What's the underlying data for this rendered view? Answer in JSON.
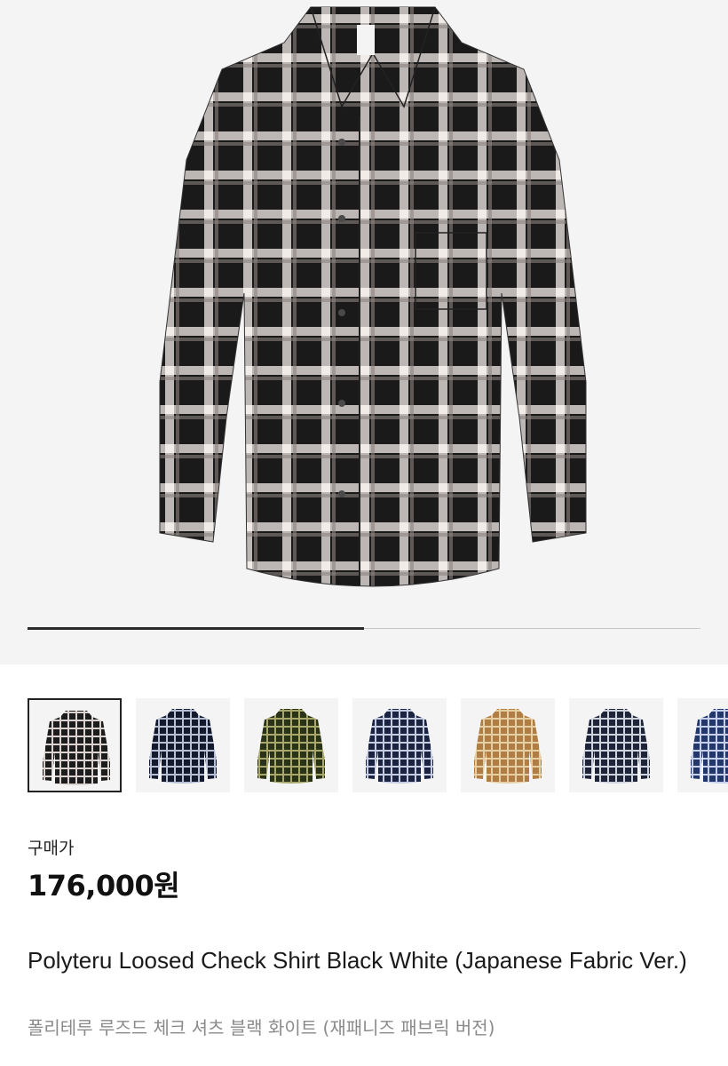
{
  "product": {
    "image_icon": "plaid-shirt-image",
    "gallery_progress_fraction": 0.5,
    "thumbnails": [
      {
        "name": "black-white",
        "dark": "#1c1c1c",
        "light": "#d9d2cf",
        "selected": true
      },
      {
        "name": "navy",
        "dark": "#141a2e",
        "light": "#b7bfd4",
        "selected": false
      },
      {
        "name": "olive",
        "dark": "#2a3318",
        "light": "#a7a86a",
        "selected": false
      },
      {
        "name": "navy-blue",
        "dark": "#1a2340",
        "light": "#c5cbe0",
        "selected": false
      },
      {
        "name": "beige",
        "dark": "#b07e44",
        "light": "#e6cfa3",
        "selected": false
      },
      {
        "name": "charcoal-navy",
        "dark": "#1f2538",
        "light": "#cfd3dd",
        "selected": false
      },
      {
        "name": "blue",
        "dark": "#23376b",
        "light": "#c6d0ea",
        "selected": false
      }
    ],
    "price_label": "구매가",
    "price": "176,000원",
    "name_en": "Polyteru Loosed Check Shirt Black White (Japanese Fabric Ver.)",
    "name_ko": "폴리테루 루즈드 체크 셔츠 블랙 화이트 (재패니즈 패브릭 버전)"
  }
}
